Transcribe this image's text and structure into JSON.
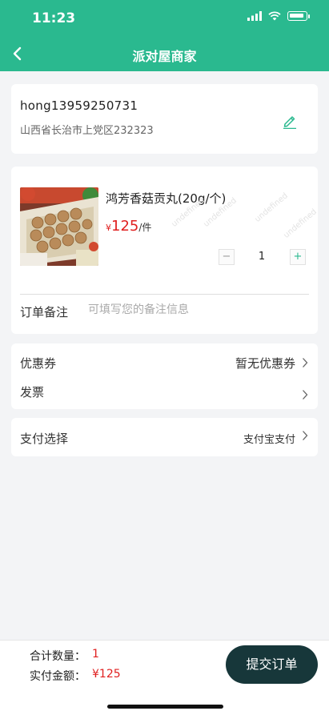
{
  "status_bar": {
    "time": "11:23"
  },
  "nav": {
    "title": "派对屋商家"
  },
  "address": {
    "name": "hong13959250731",
    "detail": "山西省长治市上党区232323"
  },
  "goods": {
    "name": "鸿芳香菇贡丸(20g/个)",
    "currency": "¥",
    "price": "125",
    "unit": "/件",
    "quantity": "1",
    "minus": "−",
    "plus": "+",
    "watermark": "undefined"
  },
  "remark": {
    "label": "订单备注",
    "placeholder": "可填写您的备注信息"
  },
  "coupon": {
    "label": "优惠券",
    "value": "暂无优惠券"
  },
  "invoice": {
    "label": "发票",
    "value": ""
  },
  "payment": {
    "label": "支付选择",
    "value": "支付宝支付"
  },
  "summary": {
    "count_label": "合计数量：",
    "count_value": "1",
    "amount_label": "实付金额：",
    "amount_value": "¥125"
  },
  "submit_label": "提交订单",
  "colors": {
    "primary": "#2ab98f",
    "price": "#e02020",
    "submit_bg": "#17373a"
  }
}
